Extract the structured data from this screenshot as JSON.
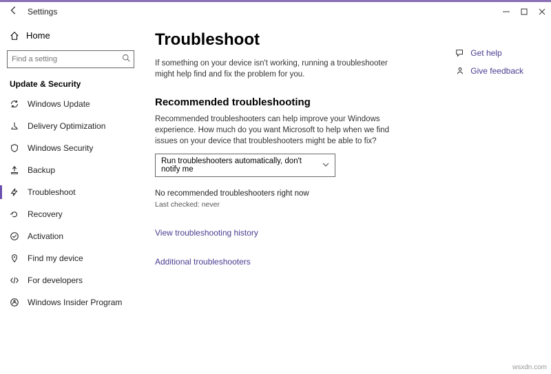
{
  "window": {
    "title": "Settings"
  },
  "sidebar": {
    "home": "Home",
    "search_placeholder": "Find a setting",
    "section": "Update & Security",
    "items": [
      {
        "label": "Windows Update"
      },
      {
        "label": "Delivery Optimization"
      },
      {
        "label": "Windows Security"
      },
      {
        "label": "Backup"
      },
      {
        "label": "Troubleshoot"
      },
      {
        "label": "Recovery"
      },
      {
        "label": "Activation"
      },
      {
        "label": "Find my device"
      },
      {
        "label": "For developers"
      },
      {
        "label": "Windows Insider Program"
      }
    ]
  },
  "main": {
    "title": "Troubleshoot",
    "intro": "If something on your device isn't working, running a troubleshooter might help find and fix the problem for you.",
    "rec_heading": "Recommended troubleshooting",
    "rec_desc": "Recommended troubleshooters can help improve your Windows experience. How much do you want Microsoft to help when we find issues on your device that troubleshooters might be able to fix?",
    "dropdown_value": "Run troubleshooters automatically, don't notify me",
    "no_rec": "No recommended troubleshooters right now",
    "last_checked": "Last checked: never",
    "history_link": "View troubleshooting history",
    "additional_link": "Additional troubleshooters"
  },
  "right": {
    "help": "Get help",
    "feedback": "Give feedback"
  },
  "watermark": "wsxdn.com"
}
